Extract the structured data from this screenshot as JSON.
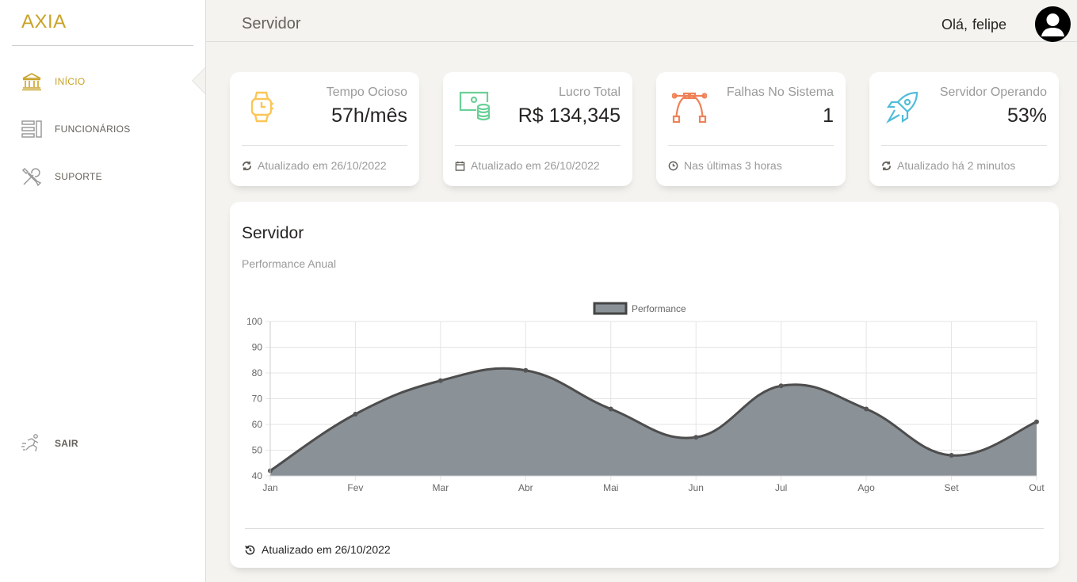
{
  "app": {
    "logo": "AXIA"
  },
  "sidebar": {
    "items": [
      {
        "label": "INÍCIO",
        "icon": "bank-icon",
        "active": true
      },
      {
        "label": "FUNCIONÁRIOS",
        "icon": "list-icon",
        "active": false
      },
      {
        "label": "SUPORTE",
        "icon": "tools-icon",
        "active": false
      }
    ],
    "logout": {
      "label": "SAIR",
      "icon": "run-icon"
    }
  },
  "header": {
    "title": "Servidor",
    "greeting": "Olá,",
    "username": "felipe"
  },
  "stats": [
    {
      "label": "Tempo Ocioso",
      "value": "57h/mês",
      "footer": "Atualizado em 26/10/2022",
      "icon": "watch-icon",
      "footer_icon": "refresh-icon",
      "color": "#fbc658"
    },
    {
      "label": "Lucro Total",
      "value": "R$ 134,345",
      "footer": "Atualizado em 26/10/2022",
      "icon": "money-coins-icon",
      "footer_icon": "calendar-icon",
      "color": "#6bd098"
    },
    {
      "label": "Falhas No Sistema",
      "value": "1",
      "footer": "Nas últimas 3 horas",
      "icon": "vector-icon",
      "footer_icon": "clock-icon",
      "color": "#ef8157"
    },
    {
      "label": "Servidor Operando",
      "value": "53%",
      "footer": "Atualizado há 2 minutos",
      "icon": "rocket-icon",
      "footer_icon": "refresh-icon",
      "color": "#51bcda"
    }
  ],
  "chart_card": {
    "title": "Servidor",
    "subtitle": "Performance Anual",
    "footer": "Atualizado em 26/10/2022"
  },
  "colors": {
    "accent": "#c9a227",
    "area_fill": "#8a9197",
    "line": "#4d4d4d"
  },
  "chart_data": {
    "type": "area",
    "categories": [
      "Jan",
      "Fev",
      "Mar",
      "Abr",
      "Mai",
      "Jun",
      "Jul",
      "Ago",
      "Set",
      "Out"
    ],
    "series": [
      {
        "name": "Performance",
        "values": [
          42,
          64,
          77,
          81,
          66,
          55,
          75,
          66,
          48,
          61
        ]
      }
    ],
    "ylim": [
      40,
      100
    ],
    "yticks": [
      40,
      50,
      60,
      70,
      80,
      90,
      100
    ],
    "grid": true,
    "legend": "top-center",
    "title": "",
    "xlabel": "",
    "ylabel": ""
  }
}
